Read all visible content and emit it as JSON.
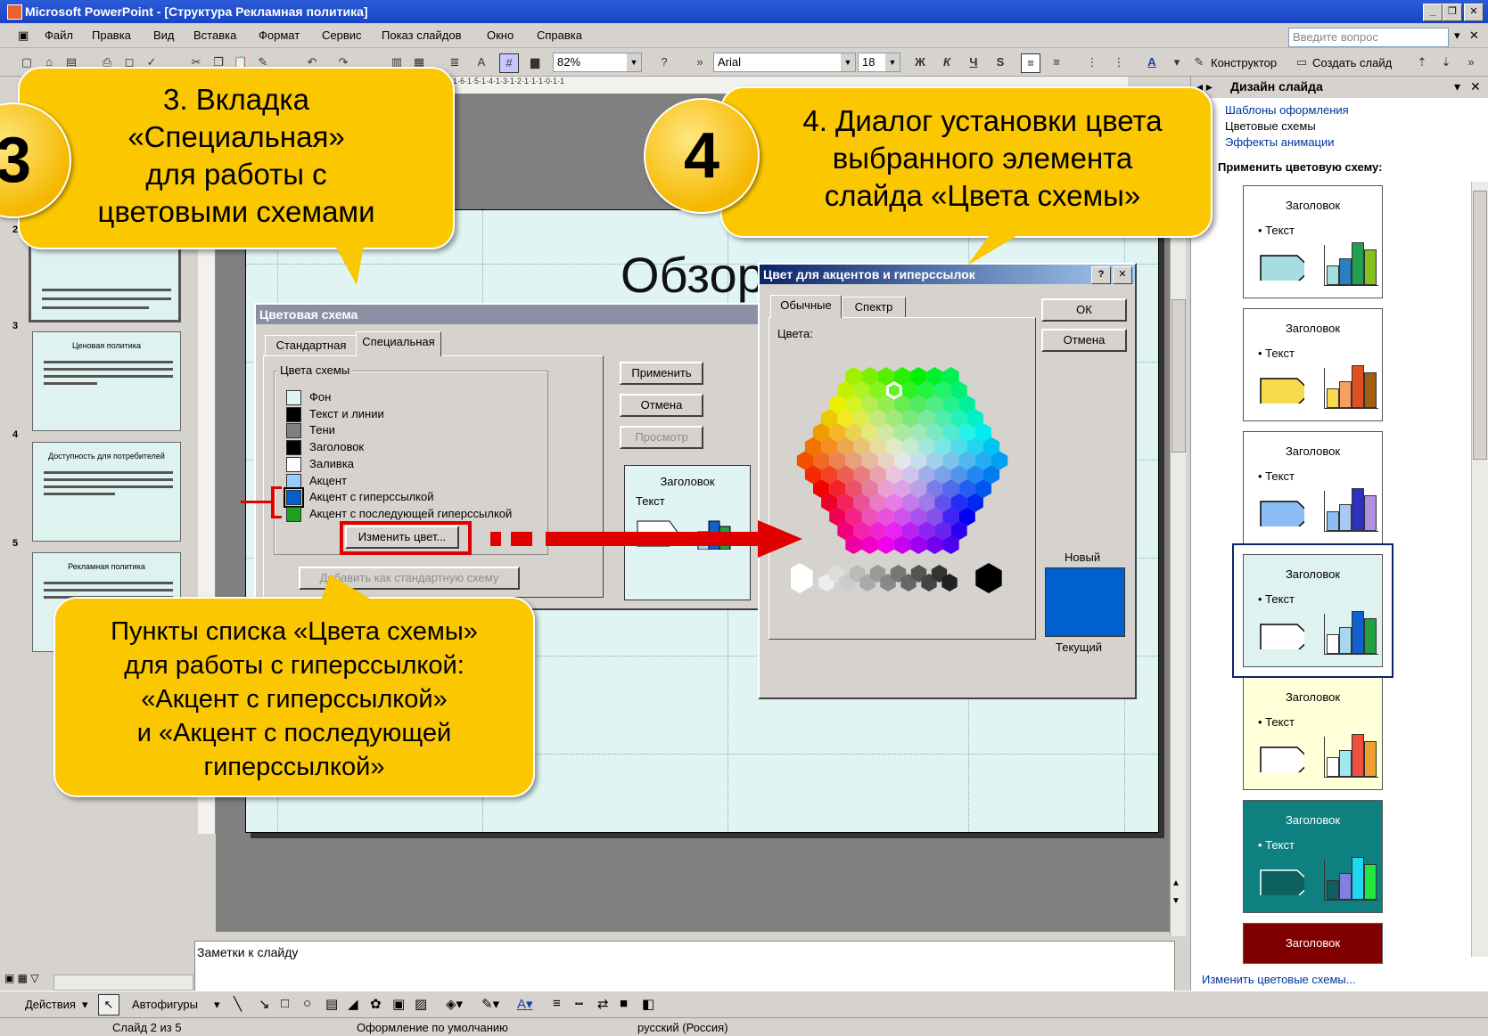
{
  "window": {
    "title": "Microsoft PowerPoint - [Структура Рекламная политика]",
    "minimize_glyph": "_",
    "restore_glyph": "❐",
    "close_glyph": "✕"
  },
  "menu": {
    "items": [
      "Файл",
      "Правка",
      "Вид",
      "Вставка",
      "Формат",
      "Сервис",
      "Показ слайдов",
      "Окно",
      "Справка"
    ],
    "help_placeholder": "Введите вопрос"
  },
  "toolbar": {
    "zoom": "82%",
    "font": "Arial",
    "font_size": "18",
    "bold": "Ж",
    "italic": "К",
    "underline": "Ч",
    "shadow": "S",
    "designer": "Конструктор",
    "new_slide": "Создать слайд"
  },
  "ruler": {
    "horizontal": "·1·6·1·5·1·4·1·3·1·2·1·1·1·0·1·1"
  },
  "thumbnails": [
    {
      "num": "2",
      "title": ""
    },
    {
      "num": "3",
      "title": "Ценовая политика"
    },
    {
      "num": "4",
      "title": "Доступность для потребителей"
    },
    {
      "num": "5",
      "title": "Рекламная политика"
    }
  ],
  "slide": {
    "title": "Обзор"
  },
  "notes": {
    "placeholder": "Заметки к слайду"
  },
  "task_pane": {
    "title": "Дизайн слайда",
    "links": [
      "Шаблоны оформления",
      "Цветовые схемы",
      "Эффекты анимации"
    ],
    "section": "Применить цветовую схему:",
    "scheme_heading": "Заголовок",
    "scheme_text": "Текст",
    "bottom_link": "Изменить цветовые схемы...",
    "schemes": [
      {
        "bg": "#ffffff",
        "title_color": "#000000",
        "arrow": "#a6dde0",
        "bars": [
          "#a6dde0",
          "#2a7fc0",
          "#22a050",
          "#88c020"
        ]
      },
      {
        "bg": "#ffffff",
        "title_color": "#000000",
        "arrow": "#f7d94c",
        "bars": [
          "#f7d94c",
          "#f5a060",
          "#e05020",
          "#a06010"
        ]
      },
      {
        "bg": "#ffffff",
        "title_color": "#000000",
        "arrow": "#8cbef5",
        "bars": [
          "#8cbef5",
          "#a6c8f5",
          "#3030c0",
          "#b090e0"
        ]
      },
      {
        "bg": "#def3f0",
        "title_color": "#000000",
        "arrow": "#ffffff",
        "bars": [
          "#ffffff",
          "#a6d8f0",
          "#1060d0",
          "#20a040"
        ]
      },
      {
        "bg": "#ffffd8",
        "title_color": "#000000",
        "arrow": "#ffffff",
        "bars": [
          "#ffffff",
          "#a0e8f0",
          "#f05040",
          "#f0a030"
        ]
      },
      {
        "bg": "#0e8080",
        "title_color": "#ffffff",
        "arrow": "#0e6060",
        "bars": [
          "#0e6060",
          "#8080e0",
          "#20d8f0",
          "#20e840"
        ]
      },
      {
        "bg": "#800000",
        "title_color": "#ffffff",
        "arrow": "#800000",
        "bars": []
      }
    ]
  },
  "draw_toolbar": {
    "actions": "Действия",
    "autoshapes": "Автофигуры"
  },
  "status": {
    "slide": "Слайд 2 из 5",
    "design": "Оформление по умолчанию",
    "language": "русский (Россия)"
  },
  "scheme_dialog": {
    "title": "Цветовая схема",
    "tab_standard": "Стандартная",
    "tab_custom": "Специальная",
    "group_label": "Цвета схемы",
    "colors": [
      {
        "label": "Фон",
        "color": "#e0f5f3"
      },
      {
        "label": "Текст и линии",
        "color": "#000000"
      },
      {
        "label": "Тени",
        "color": "#808080"
      },
      {
        "label": "Заголовок",
        "color": "#000000"
      },
      {
        "label": "Заливка",
        "color": "#ffffff"
      },
      {
        "label": "Акцент",
        "color": "#99ccff"
      },
      {
        "label": "Акцент с гиперссылкой",
        "color": "#0060d0"
      },
      {
        "label": "Акцент с последующей гиперссылкой",
        "color": "#20a020"
      }
    ],
    "change_color": "Изменить цвет...",
    "add_standard": "Добавить как стандартную схему",
    "apply": "Применить",
    "cancel": "Отмена",
    "preview": "Просмотр",
    "preview_heading": "Заголовок",
    "preview_text": "Текст"
  },
  "color_dialog": {
    "title": "Цвет для акцентов и гиперссылок",
    "help_glyph": "?",
    "close_glyph": "✕",
    "tab_standard": "Обычные",
    "tab_spectrum": "Спектр",
    "colors_label": "Цвета:",
    "ok": "ОК",
    "cancel": "Отмена",
    "new_label": "Новый",
    "current_label": "Текущий",
    "new_color": "#0060d0"
  },
  "callouts": {
    "c3_num": "3",
    "c3_lines": [
      "3. Вкладка",
      "«Специальная»",
      "для работы с",
      "цветовыми схемами"
    ],
    "c4_num": "4",
    "c4_lines": [
      "4. Диалог установки цвета",
      "выбранного элемента",
      "слайда «Цвета схемы»"
    ],
    "c5_lines": [
      "Пункты списка «Цвета схемы»",
      "для работы с гиперссылкой:",
      "«Акцент с гиперссылкой»",
      "и «Акцент с последующей",
      "гиперссылкой»"
    ]
  }
}
